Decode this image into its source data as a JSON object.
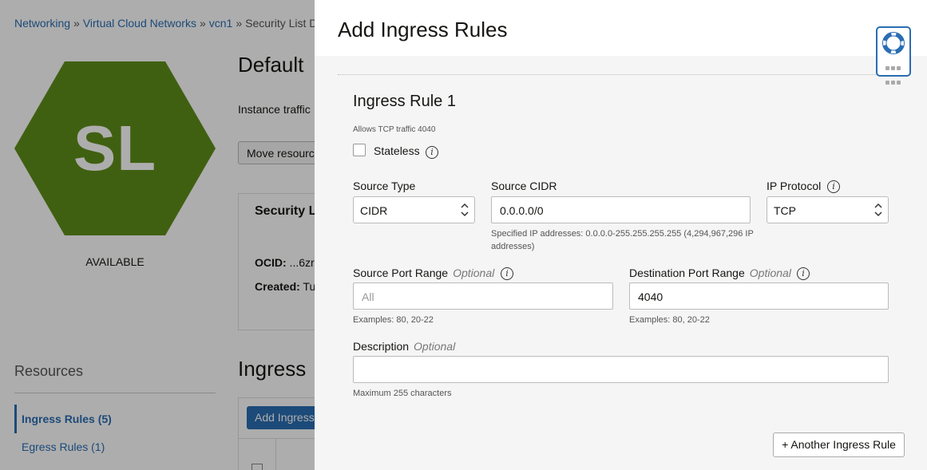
{
  "breadcrumb": {
    "items": [
      "Networking",
      "Virtual Cloud Networks",
      "vcn1"
    ],
    "separator": "»",
    "current": "Security List D"
  },
  "resource": {
    "initials": "SL",
    "hex_color": "#5f8e1a",
    "status": "AVAILABLE",
    "title": "Default",
    "description": "Instance traffic",
    "move_button": "Move resourc",
    "info_title": "Security L",
    "ocid_label": "OCID:",
    "ocid_value": " ...6zr",
    "created_label": "Created:",
    "created_value": " Tu"
  },
  "resources_nav": {
    "title": "Resources",
    "items": [
      {
        "label": "Ingress Rules (5)",
        "active": true
      },
      {
        "label": "Egress Rules (1)",
        "active": false
      }
    ]
  },
  "bg_section": {
    "title": "Ingress",
    "add_button": "Add Ingress"
  },
  "panel": {
    "title": "Add Ingress Rules",
    "rule": {
      "title": "Ingress Rule 1",
      "subtitle": "Allows TCP traffic 4040",
      "stateless_label": "Stateless",
      "stateless_checked": false,
      "source_type": {
        "label": "Source Type",
        "value": "CIDR"
      },
      "source_cidr": {
        "label": "Source CIDR",
        "value": "0.0.0.0/0",
        "hint": "Specified IP addresses: 0.0.0.0-255.255.255.255 (4,294,967,296 IP addresses)"
      },
      "ip_protocol": {
        "label": "IP Protocol",
        "value": "TCP"
      },
      "source_port": {
        "label": "Source Port Range",
        "optional": "Optional",
        "placeholder": "All",
        "hint": "Examples: 80, 20-22"
      },
      "dest_port": {
        "label": "Destination Port Range",
        "optional": "Optional",
        "value": "4040",
        "hint": "Examples: 80, 20-22"
      },
      "description": {
        "label": "Description",
        "optional": "Optional",
        "value": "",
        "hint": "Maximum 255 characters"
      }
    },
    "another_button": "+ Another Ingress Rule"
  },
  "icons": {
    "help": "lifering-icon",
    "info": "info-icon",
    "select": "chevron-updown-icon"
  },
  "colors": {
    "link": "#2a6db3",
    "hex": "#5f8e1a",
    "primary_button": "#2a6db3"
  }
}
